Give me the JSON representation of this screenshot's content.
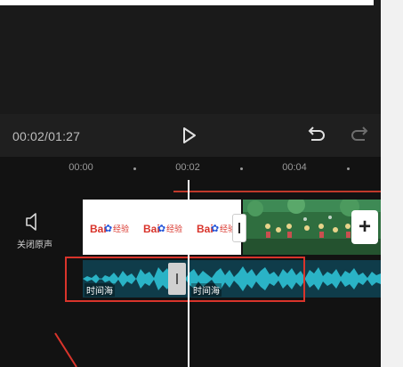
{
  "player": {
    "time": "00:02/01:27",
    "play_icon": "play-icon",
    "undo_icon": "undo-icon",
    "redo_icon": "redo-icon"
  },
  "ruler": {
    "labels": [
      "00:00",
      "00:02",
      "00:04"
    ]
  },
  "sidebar": {
    "mute_label": "关闭原声",
    "mute_icon": "speaker-icon"
  },
  "video_track": {
    "clip_logo_text": "Bai",
    "clip_logo_suffix": "经验",
    "add_icon": "+"
  },
  "audio_track": {
    "clip_labels": [
      "时间海",
      "时间海"
    ]
  },
  "colors": {
    "background": "#121212",
    "waveform": "#2ab3c6",
    "highlight": "#d9342b"
  }
}
